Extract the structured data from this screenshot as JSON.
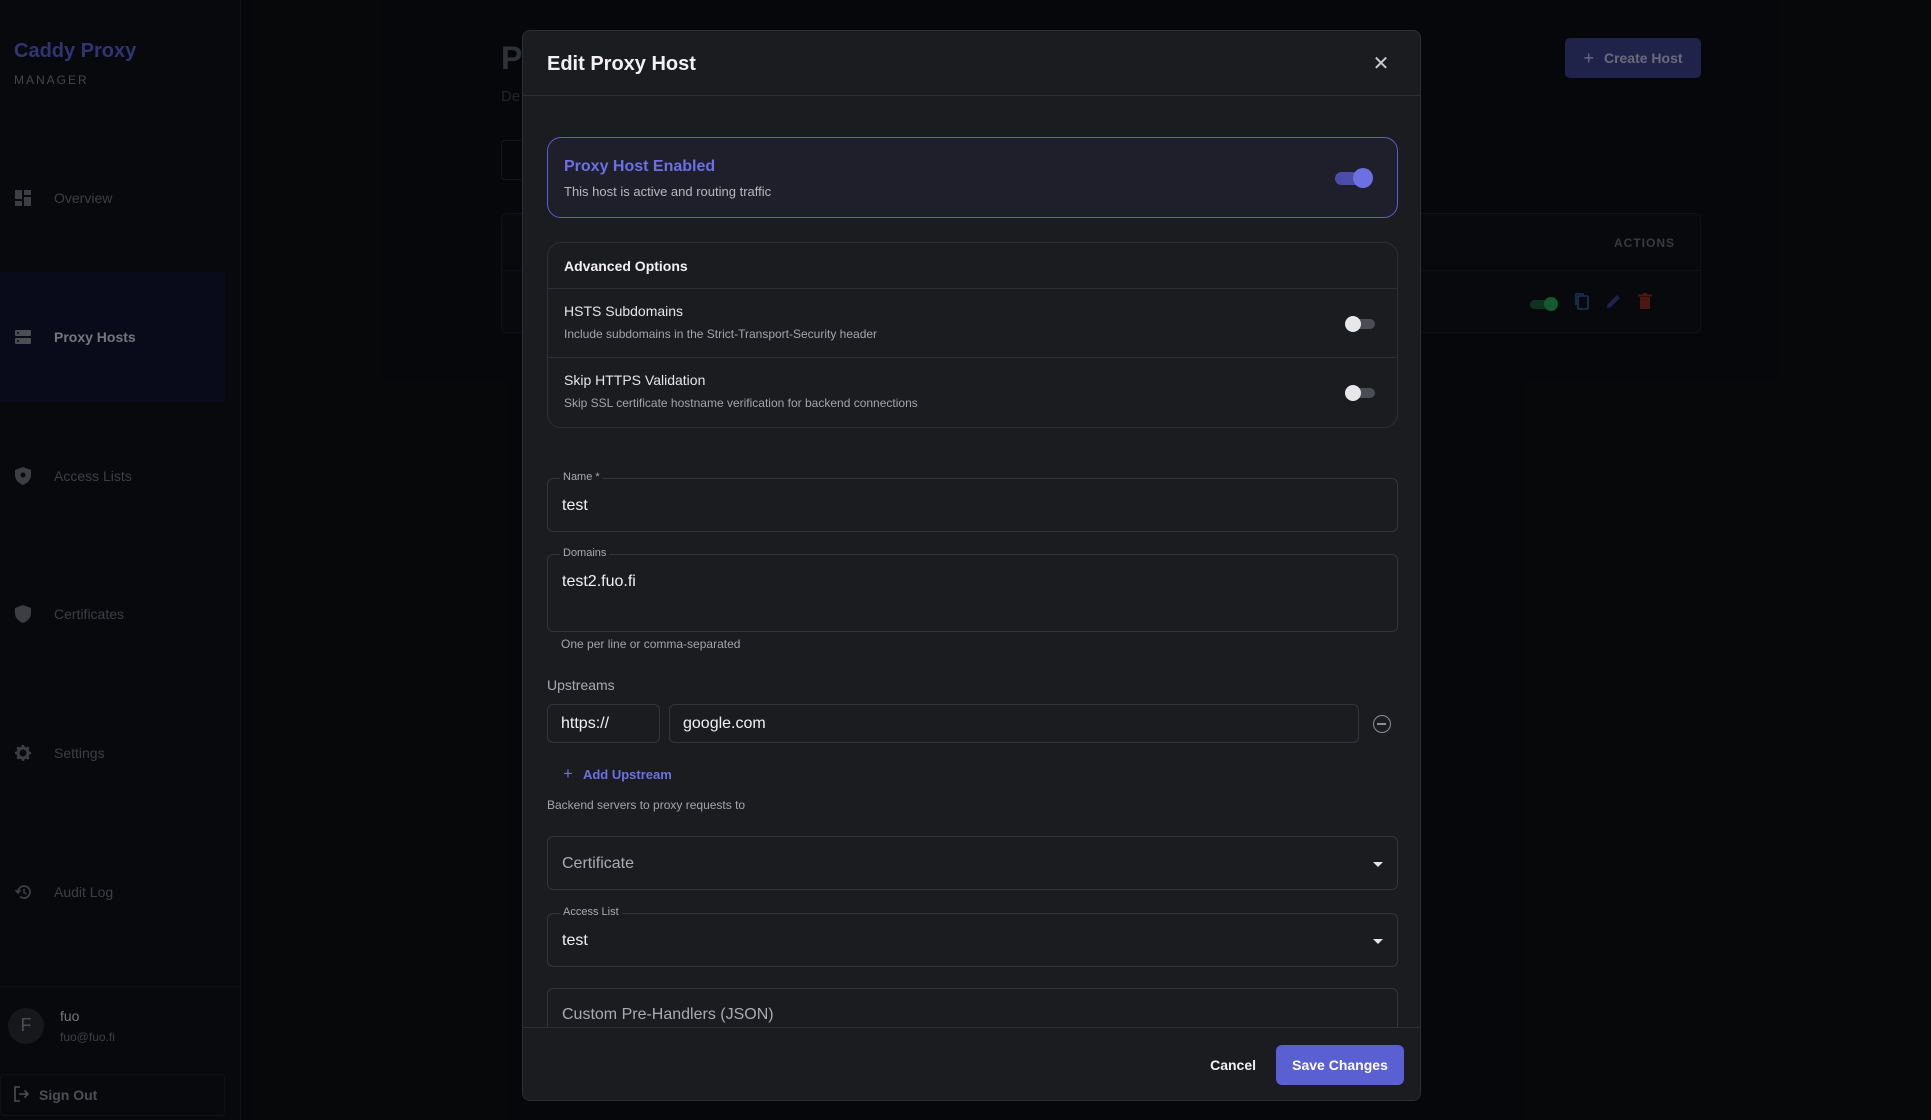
{
  "app": {
    "name": "Caddy Proxy",
    "subtitle": "MANAGER"
  },
  "sidebar": {
    "items": [
      {
        "label": "Overview",
        "icon": "dashboard-icon"
      },
      {
        "label": "Proxy Hosts",
        "icon": "server-icon",
        "active": true
      },
      {
        "label": "Access Lists",
        "icon": "shield-lock-icon"
      },
      {
        "label": "Certificates",
        "icon": "shield-icon"
      },
      {
        "label": "Settings",
        "icon": "gear-icon"
      },
      {
        "label": "Audit Log",
        "icon": "history-icon"
      }
    ],
    "user": {
      "initial": "F",
      "name": "fuo",
      "email": "fuo@fuo.fi"
    },
    "signout_label": "Sign Out"
  },
  "background_page": {
    "title_partial": "P",
    "desc_partial": "De",
    "create_button": "Create Host",
    "actions_header": "ACTIONS"
  },
  "modal": {
    "title": "Edit Proxy Host",
    "enabled": {
      "title": "Proxy Host Enabled",
      "subtitle": "This host is active and routing traffic",
      "value": true
    },
    "advanced": {
      "heading": "Advanced Options",
      "options": [
        {
          "title": "HSTS Subdomains",
          "desc": "Include subdomains in the Strict-Transport-Security header",
          "value": false
        },
        {
          "title": "Skip HTTPS Validation",
          "desc": "Skip SSL certificate hostname verification for backend connections",
          "value": false
        }
      ]
    },
    "name": {
      "label": "Name *",
      "value": "test"
    },
    "domains": {
      "label": "Domains",
      "value": "test2.fuo.fi",
      "helper": "One per line or comma-separated"
    },
    "upstreams": {
      "label": "Upstreams",
      "items": [
        {
          "scheme": "https://",
          "host": "google.com"
        }
      ],
      "add_label": "Add Upstream",
      "helper": "Backend servers to proxy requests to"
    },
    "certificate": {
      "placeholder": "Certificate"
    },
    "access_list": {
      "label": "Access List",
      "value": "test"
    },
    "pre_handlers": {
      "placeholder": "Custom Pre-Handlers (JSON)"
    },
    "footer": {
      "cancel": "Cancel",
      "save": "Save Changes"
    }
  },
  "colors": {
    "accent": "#5a5fd1",
    "accent_light": "#6c70e3",
    "success": "#27a356",
    "danger": "#c0392b"
  }
}
